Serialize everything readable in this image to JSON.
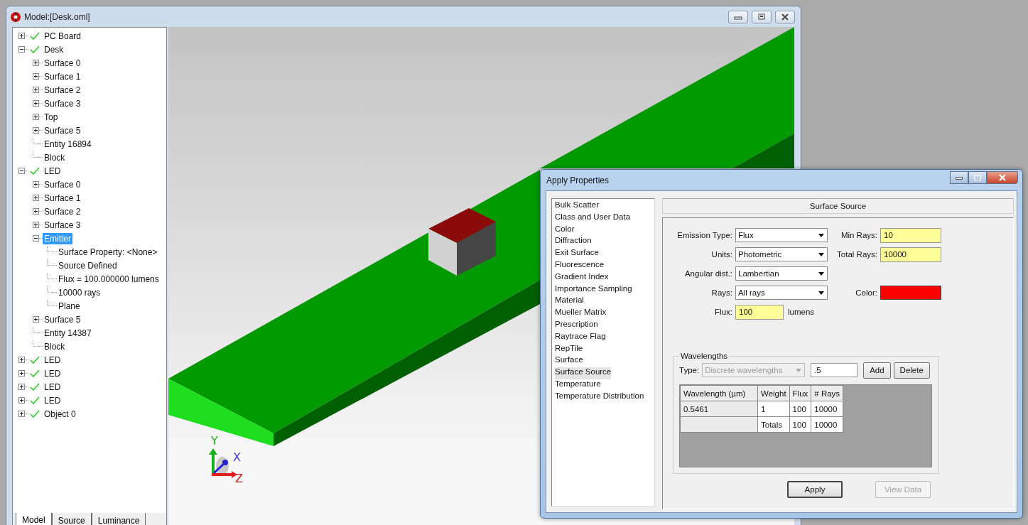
{
  "window": {
    "title": "Model:[Desk.oml]"
  },
  "tree": {
    "items": [
      {
        "label": "PC Board",
        "checked": true,
        "expanded": false,
        "selected": false
      },
      {
        "label": "Desk",
        "checked": true,
        "expanded": true,
        "selected": false,
        "children": [
          {
            "label": "Surface 0",
            "expanded": false,
            "selected": false
          },
          {
            "label": "Surface 1",
            "expanded": false,
            "selected": false
          },
          {
            "label": "Surface 2",
            "expanded": false,
            "selected": false
          },
          {
            "label": "Surface 3",
            "expanded": false,
            "selected": false
          },
          {
            "label": "Top",
            "expanded": false,
            "selected": false
          },
          {
            "label": "Surface 5",
            "expanded": false,
            "selected": false
          },
          {
            "label": "Entity 16894",
            "selected": false
          },
          {
            "label": "Block",
            "selected": false
          }
        ]
      },
      {
        "label": "LED",
        "checked": true,
        "expanded": true,
        "selected": false,
        "children": [
          {
            "label": "Surface 0",
            "expanded": false,
            "selected": false
          },
          {
            "label": "Surface 1",
            "expanded": false,
            "selected": false
          },
          {
            "label": "Surface 2",
            "expanded": false,
            "selected": false
          },
          {
            "label": "Surface 3",
            "expanded": false,
            "selected": false
          },
          {
            "label": "Emitter",
            "expanded": true,
            "selected": true,
            "children": [
              {
                "label": "Surface Property: <None>",
                "selected": false
              },
              {
                "label": "Source Defined",
                "selected": false
              },
              {
                "label": "Flux = 100.000000 lumens",
                "selected": false
              },
              {
                "label": "10000 rays",
                "selected": false
              },
              {
                "label": "Plane",
                "selected": false
              }
            ]
          },
          {
            "label": "Surface 5",
            "expanded": false,
            "selected": false
          },
          {
            "label": "Entity 14387",
            "selected": false
          },
          {
            "label": "Block",
            "selected": false
          }
        ]
      },
      {
        "label": "LED",
        "checked": true,
        "expanded": false,
        "selected": false
      },
      {
        "label": "LED",
        "checked": true,
        "expanded": false,
        "selected": false
      },
      {
        "label": "LED",
        "checked": true,
        "expanded": false,
        "selected": false
      },
      {
        "label": "LED",
        "checked": true,
        "expanded": false,
        "selected": false
      },
      {
        "label": "Object 0",
        "checked": true,
        "expanded": false,
        "selected": false
      }
    ]
  },
  "panel_tabs": [
    {
      "label": "Model",
      "selected": true
    },
    {
      "label": "Source",
      "selected": false
    },
    {
      "label": "Luminance",
      "selected": false
    }
  ],
  "viewport": {
    "axis_y": "Y",
    "axis_x": "X",
    "axis_z": "Z"
  },
  "dialog": {
    "title": "Apply Properties",
    "categories": [
      {
        "label": "Bulk Scatter",
        "selected": false
      },
      {
        "label": "Class and User Data",
        "selected": false
      },
      {
        "label": "Color",
        "selected": false
      },
      {
        "label": "Diffraction",
        "selected": false
      },
      {
        "label": "Exit Surface",
        "selected": false
      },
      {
        "label": "Fluorescence",
        "selected": false
      },
      {
        "label": "Gradient Index",
        "selected": false
      },
      {
        "label": "Importance Sampling",
        "selected": false
      },
      {
        "label": "Material",
        "selected": false
      },
      {
        "label": "Mueller Matrix",
        "selected": false
      },
      {
        "label": "Prescription",
        "selected": false
      },
      {
        "label": "Raytrace Flag",
        "selected": false
      },
      {
        "label": "RepTile",
        "selected": false
      },
      {
        "label": "Surface",
        "selected": false
      },
      {
        "label": "Surface Source",
        "selected": true
      },
      {
        "label": "Temperature",
        "selected": false
      },
      {
        "label": "Temperature Distribution",
        "selected": false
      }
    ],
    "section_title": "Surface Source",
    "rows": [
      {
        "fields": [
          {
            "kind": "dropdown",
            "label": "Emission Type:",
            "value": "Flux"
          },
          {
            "kind": "text",
            "label": "Min Rays:",
            "value": "10"
          }
        ]
      },
      {
        "fields": [
          {
            "kind": "dropdown",
            "label": "Units:",
            "value": "Photometric"
          },
          {
            "kind": "text",
            "label": "Total Rays:",
            "value": "10000"
          }
        ]
      },
      {
        "fields": [
          {
            "kind": "dropdown",
            "label": "Angular dist.:",
            "value": "Lambertian"
          }
        ]
      },
      {
        "fields": [
          {
            "kind": "dropdown",
            "label": "Rays:",
            "value": "All rays"
          },
          {
            "kind": "color",
            "label": "Color:",
            "color": "#ff0000"
          }
        ]
      },
      {
        "fields": [
          {
            "kind": "text",
            "label": "Flux:",
            "value": "100",
            "unit": "lumens"
          }
        ]
      }
    ],
    "wavelengths": {
      "title": "Wavelengths",
      "type_label": "Type:",
      "type_value": "Discrete wavelengths",
      "type_disabled": true,
      "entry_value": ".5",
      "buttons": [
        {
          "label": "Add",
          "disabled": false
        },
        {
          "label": "Delete",
          "disabled": false
        }
      ],
      "table": {
        "columns": [
          "Wavelength (µm)",
          "Weight",
          "Flux",
          "# Rays"
        ],
        "rows": [
          {
            "cells": [
              "0.5461",
              "1",
              "100",
              "10000"
            ]
          },
          {
            "cells": [
              "",
              "Totals",
              "100",
              "10000"
            ]
          }
        ]
      }
    },
    "buttons": [
      {
        "label": "Apply",
        "disabled": false
      },
      {
        "label": "View Data",
        "disabled": true
      }
    ]
  }
}
